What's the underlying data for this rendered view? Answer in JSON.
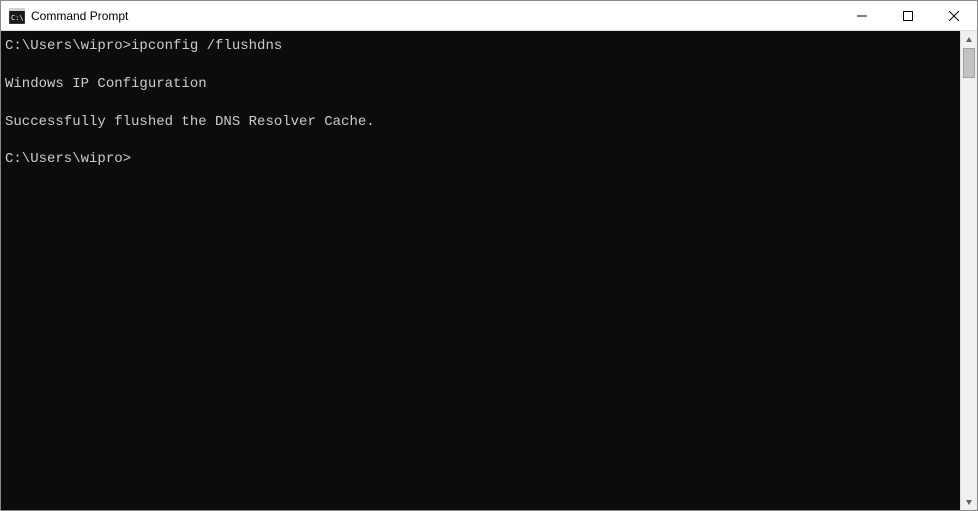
{
  "window": {
    "title": "Command Prompt"
  },
  "terminal": {
    "line1_prompt": "C:\\Users\\wipro>",
    "line1_cmd": "ipconfig /flushdns",
    "line2": "Windows IP Configuration",
    "line3": "Successfully flushed the DNS Resolver Cache.",
    "line4_prompt": "C:\\Users\\wipro>"
  }
}
